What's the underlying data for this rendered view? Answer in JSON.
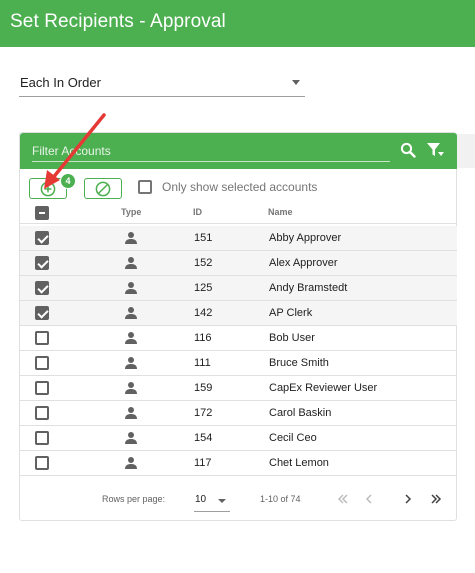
{
  "header": {
    "title": "Set Recipients - Approval"
  },
  "order": {
    "value": "Each In Order"
  },
  "filter": {
    "placeholder": "Filter Accounts"
  },
  "toolbar": {
    "selected_count": "4",
    "only_selected_label": "Only show selected accounts"
  },
  "columns": {
    "type": "Type",
    "id": "ID",
    "name": "Name"
  },
  "rows": [
    {
      "id": "151",
      "name": "Abby Approver",
      "selected": true,
      "type_icon": "person-icon"
    },
    {
      "id": "152",
      "name": "Alex Approver",
      "selected": true,
      "type_icon": "person-icon"
    },
    {
      "id": "125",
      "name": "Andy Bramstedt",
      "selected": true,
      "type_icon": "person-icon"
    },
    {
      "id": "142",
      "name": "AP Clerk",
      "selected": true,
      "type_icon": "person-icon"
    },
    {
      "id": "116",
      "name": "Bob User",
      "selected": false,
      "type_icon": "person-icon"
    },
    {
      "id": "111",
      "name": "Bruce Smith",
      "selected": false,
      "type_icon": "person-icon"
    },
    {
      "id": "159",
      "name": "CapEx Reviewer User",
      "selected": false,
      "type_icon": "person-icon"
    },
    {
      "id": "172",
      "name": "Carol Baskin",
      "selected": false,
      "type_icon": "person-icon"
    },
    {
      "id": "154",
      "name": "Cecil Ceo",
      "selected": false,
      "type_icon": "person-icon"
    },
    {
      "id": "117",
      "name": "Chet Lemon",
      "selected": false,
      "type_icon": "person-icon"
    }
  ],
  "pagination": {
    "rows_per_page_label": "Rows per page:",
    "rows_per_page": "10",
    "range": "1-10 of 74"
  },
  "colors": {
    "primary": "#4caf50",
    "arrow": "#e53935",
    "checkbox": "#616161"
  }
}
